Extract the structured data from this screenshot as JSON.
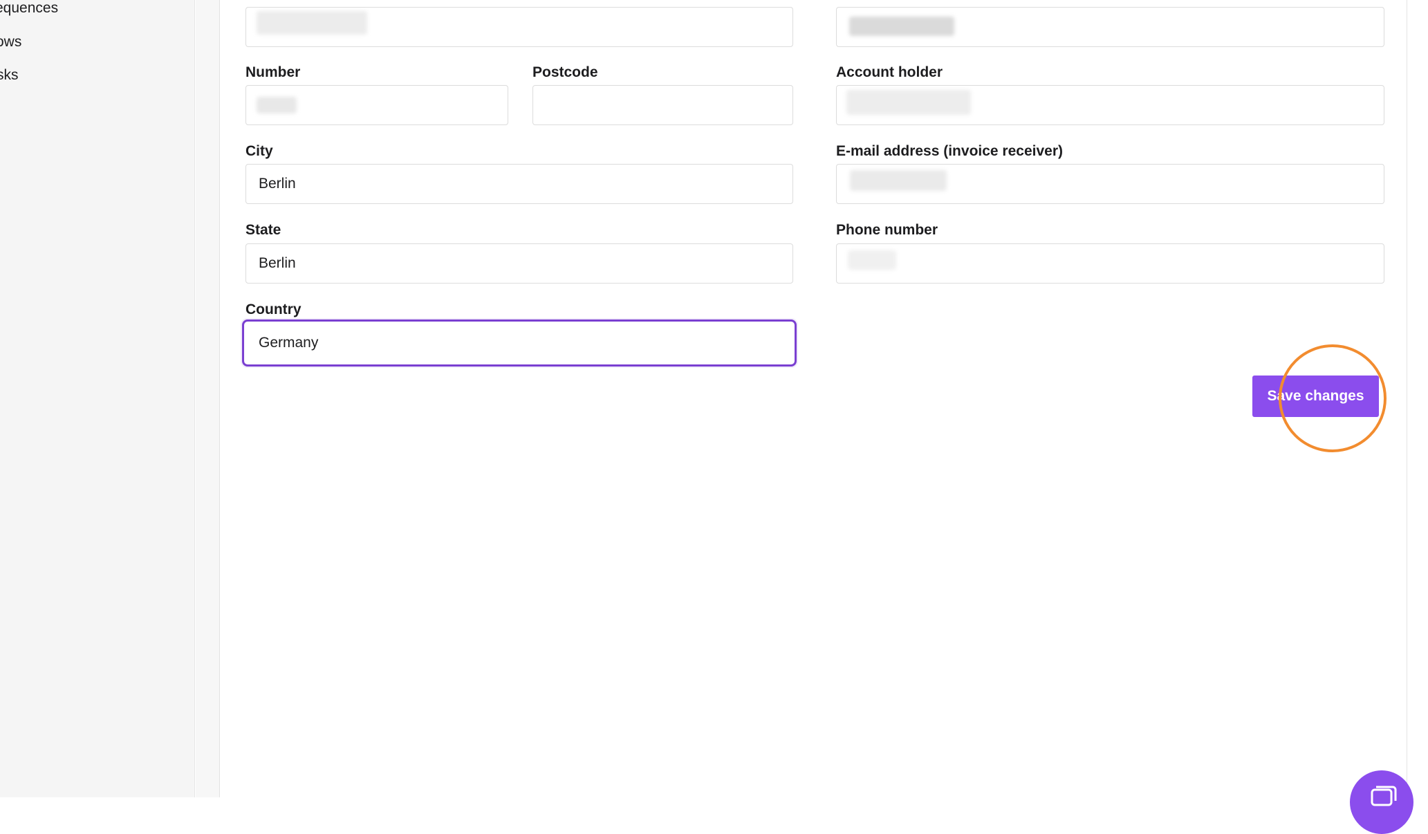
{
  "sidebar": {
    "items": [
      {
        "label": "equences"
      },
      {
        "label": "ows"
      },
      {
        "label": "sks"
      }
    ]
  },
  "form": {
    "number": {
      "label": "Number",
      "value": ""
    },
    "postcode": {
      "label": "Postcode",
      "value": ""
    },
    "city": {
      "label": "City",
      "value": "Berlin"
    },
    "state": {
      "label": "State",
      "value": "Berlin"
    },
    "country": {
      "label": "Country",
      "value": "Germany"
    },
    "account_holder": {
      "label": "Account holder",
      "value": ""
    },
    "email": {
      "label": "E-mail address (invoice receiver)",
      "value": ""
    },
    "phone": {
      "label": "Phone number",
      "value": ""
    }
  },
  "actions": {
    "save_label": "Save changes"
  },
  "colors": {
    "accent": "#8b4ded",
    "focus_border": "#7a3fd1",
    "click_highlight": "#f28c2f"
  },
  "icons": {
    "chat_fab": "chat-icon"
  }
}
